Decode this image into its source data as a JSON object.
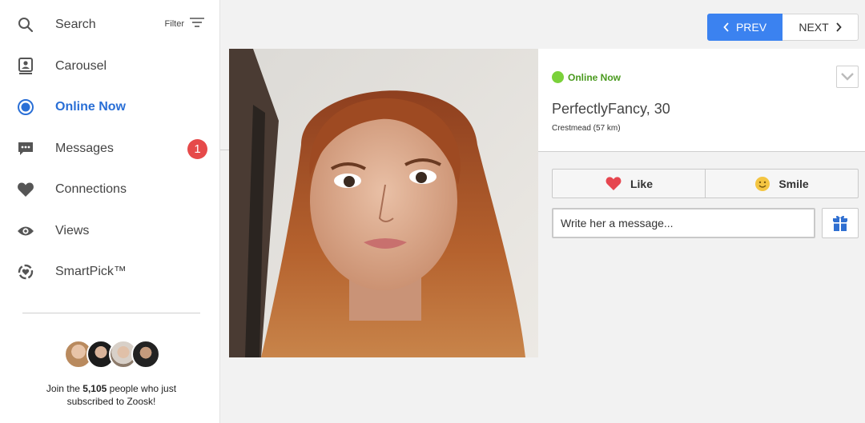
{
  "sidebar": {
    "search_label": "Search",
    "filter_label": "Filter",
    "items": [
      {
        "label": "Carousel",
        "icon": "carousel-icon"
      },
      {
        "label": "Online Now",
        "icon": "online-now-icon",
        "active": true
      },
      {
        "label": "Messages",
        "icon": "messages-icon",
        "badge": "1"
      },
      {
        "label": "Connections",
        "icon": "heart-icon"
      },
      {
        "label": "Views",
        "icon": "eye-icon"
      },
      {
        "label": "SmartPick™",
        "icon": "smartpick-icon"
      }
    ],
    "promo": {
      "prefix": "Join the ",
      "count": "5,105",
      "suffix": " people who just subscribed to Zoosk!"
    }
  },
  "pager": {
    "prev_label": "PREV",
    "next_label": "NEXT"
  },
  "profile": {
    "status": "Online Now",
    "name": "PerfectlyFancy, 30",
    "location": "Crestmead (57 km)"
  },
  "actions": {
    "like_label": "Like",
    "smile_label": "Smile"
  },
  "message": {
    "placeholder": "Write her a message..."
  },
  "colors": {
    "accent": "#3b82f0",
    "active_nav": "#2a6fd6",
    "online": "#7ad13a",
    "badge": "#e64a4a",
    "like": "#e6464f"
  }
}
